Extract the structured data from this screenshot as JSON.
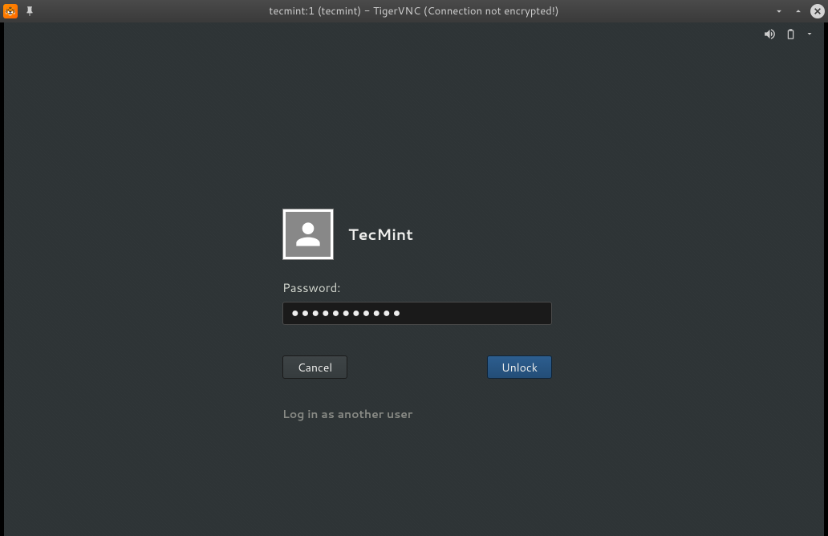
{
  "window": {
    "title": "tecmint:1 (tecmint) - TigerVNC (Connection not encrypted!)"
  },
  "login": {
    "username": "TecMint",
    "password_label": "Password:",
    "password_value": "●●●●●●●●●●●",
    "cancel_label": "Cancel",
    "unlock_label": "Unlock",
    "other_user_label": "Log in as another user"
  }
}
